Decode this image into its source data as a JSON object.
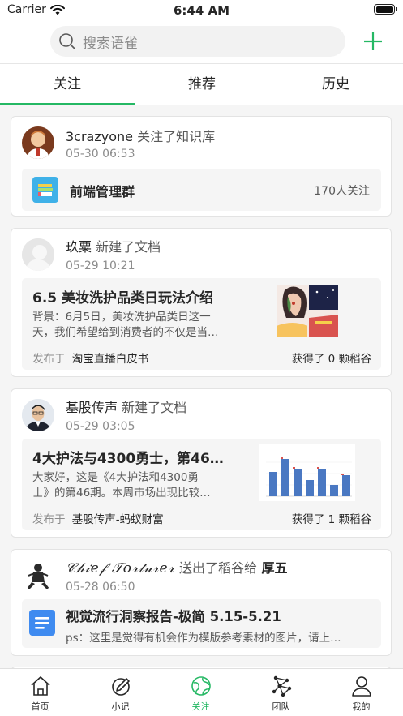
{
  "status_bar": {
    "carrier": "Carrier",
    "time": "6:44 AM"
  },
  "search": {
    "placeholder": "搜索语雀"
  },
  "tabs": [
    {
      "label": "关注",
      "active": true
    },
    {
      "label": "推荐",
      "active": false
    },
    {
      "label": "历史",
      "active": false
    }
  ],
  "accent_color": "#25b864",
  "feed": [
    {
      "user": "3crazyone",
      "action": "关注了知识库",
      "time": "05-30 06:53",
      "repo": {
        "name": "前端管理群",
        "followers": "170人关注"
      }
    },
    {
      "user": "玖粟",
      "action": "新建了文档",
      "time": "05-29 10:21",
      "doc": {
        "title": "6.5 美妆洗护品类日玩法介绍",
        "excerpt_line1": "背景：6月5日，美妆洗护品类日这一",
        "excerpt_line2": "天，我们希望给到消费者的不仅是当…",
        "published_prefix": "发布于",
        "published_in": "淘宝直播白皮书",
        "reward": "获得了 0 颗稻谷"
      }
    },
    {
      "user": "基股传声",
      "action": "新建了文档",
      "time": "05-29 03:05",
      "doc": {
        "title": "4大护法与4300勇士，第46…",
        "excerpt_line1": "大家好，这是《4大护法和4300勇",
        "excerpt_line2": "士》的第46期。本周市场出现比较…",
        "published_prefix": "发布于",
        "published_in": "基股传声-蚂蚁财富",
        "reward": "获得了 1 颗稻谷"
      }
    },
    {
      "user": "𝒞𝒽𝒾𝑒𝒻 𝒯𝑜𝓇𝓉𝓊𝓇𝑒𝓇",
      "action": "送出了稻谷给",
      "target": "厚五",
      "time": "05-28 06:50",
      "doc": {
        "title": "视觉流行洞察报告-极简 5.15-5.21",
        "excerpt_line1": "ps：这里是觉得有机会作为模版参考素材的图片，请上…"
      }
    }
  ],
  "tabbar": [
    {
      "label": "首页",
      "icon": "home-icon"
    },
    {
      "label": "小记",
      "icon": "pen-icon"
    },
    {
      "label": "关注",
      "icon": "globe-icon",
      "active": true
    },
    {
      "label": "团队",
      "icon": "team-icon"
    },
    {
      "label": "我的",
      "icon": "person-icon"
    }
  ]
}
